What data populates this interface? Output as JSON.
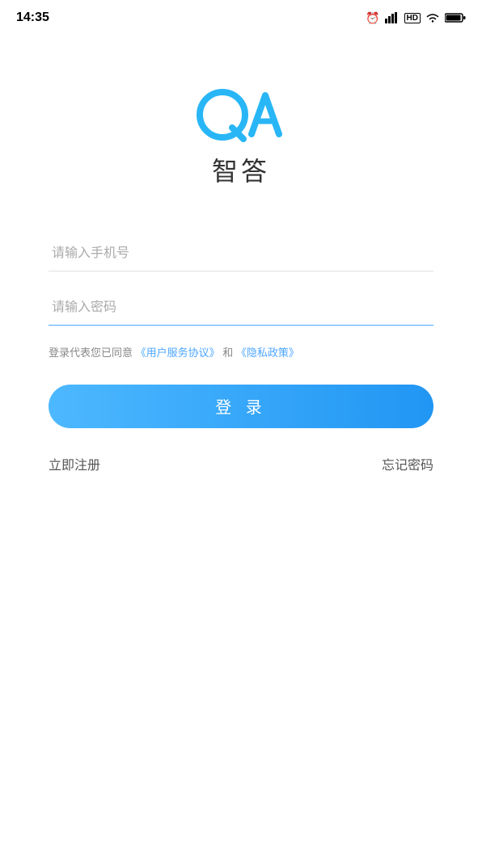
{
  "statusBar": {
    "time": "14:35"
  },
  "logo": {
    "appName": "智答"
  },
  "form": {
    "phonePlaceholder": "请输入手机号",
    "passwordPlaceholder": "请输入密码",
    "agreementPrefix": "登录代表您已同意",
    "agreementService": "《用户服务协议》",
    "agreementAnd": "和",
    "agreementPrivacy": "《隐私政策》",
    "loginButton": "登 录",
    "registerLink": "立即注册",
    "forgotPassword": "忘记密码"
  },
  "colors": {
    "accent": "#2196f3",
    "accentLight": "#4db8ff",
    "text": "#333333",
    "placeholder": "#aaaaaa",
    "border": "#e0e0e0",
    "linkColor": "#4da6ff"
  }
}
